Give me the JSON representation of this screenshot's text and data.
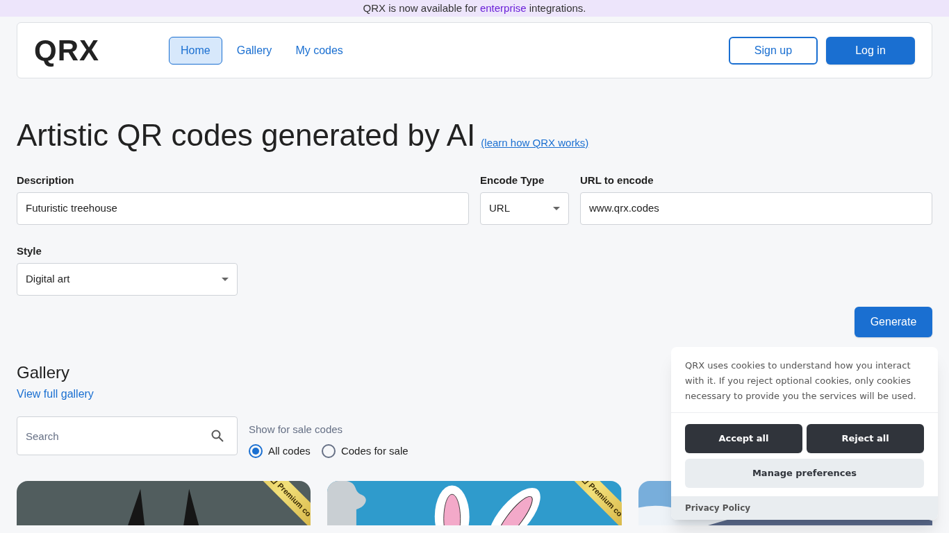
{
  "banner": {
    "text": "QRX is now available for ",
    "link": "enterprise",
    "rest": " integrations."
  },
  "header": {
    "logo": "QRX",
    "nav": [
      {
        "label": "Home",
        "selected": true
      },
      {
        "label": "Gallery",
        "selected": false
      },
      {
        "label": "My codes",
        "selected": false
      }
    ],
    "signup": "Sign up",
    "login": "Log in"
  },
  "hero": {
    "title": "Artistic QR codes generated by AI",
    "link": "(learn how QRX works)"
  },
  "form": {
    "description": {
      "label": "Description",
      "value": "Futuristic treehouse"
    },
    "encode_type": {
      "label": "Encode Type",
      "value": "URL"
    },
    "url": {
      "label": "URL to encode",
      "value": "www.qrx.codes"
    },
    "style": {
      "label": "Style",
      "value": "Digital art"
    },
    "generate": "Generate"
  },
  "gallery": {
    "title": "Gallery",
    "link": "View full gallery",
    "search": {
      "placeholder": "Search"
    },
    "filter_label": "Show for sale codes",
    "options": [
      {
        "label": "All codes",
        "selected": true
      },
      {
        "label": "Codes for sale",
        "selected": false
      }
    ],
    "cards": [
      {
        "kind": "dark",
        "ribbon": "Premium co"
      },
      {
        "kind": "bunny",
        "ribbon": "Premium co"
      },
      {
        "kind": "mountain"
      }
    ]
  },
  "cookies": {
    "text": "QRX uses cookies to understand how you interact with it. If you reject optional cookies, only cookies necessary to provide you the services will be used.",
    "accept": "Accept all",
    "reject": "Reject all",
    "manage": "Manage preferences",
    "privacy": "Privacy Policy"
  }
}
